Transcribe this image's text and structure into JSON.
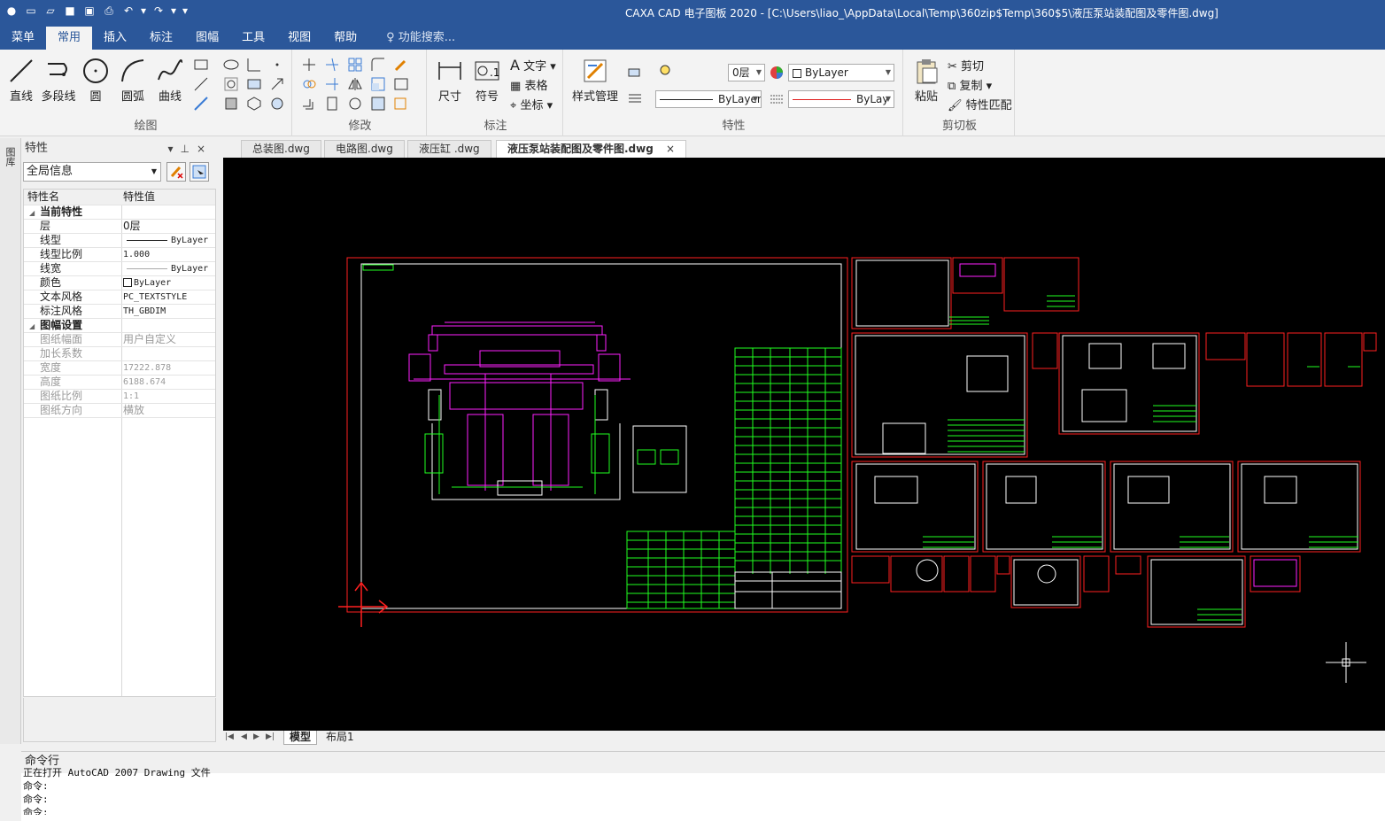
{
  "window": {
    "title": "CAXA CAD 电子图板 2020 - [C:\\Users\\liao_\\AppData\\Local\\Temp\\360zip$Temp\\360$5\\液压泵站装配图及零件图.dwg]"
  },
  "menu": {
    "tabs": [
      "菜单",
      "常用",
      "插入",
      "标注",
      "图幅",
      "工具",
      "视图",
      "帮助"
    ],
    "active": "常用",
    "search_placeholder": "功能搜索..."
  },
  "ribbon": {
    "draw": {
      "label": "绘图",
      "line": "直线",
      "polyline": "多段线",
      "circle": "圆",
      "arc": "圆弧",
      "curve": "曲线"
    },
    "modify": {
      "label": "修改"
    },
    "annotate": {
      "label": "标注",
      "dimension": "尺寸",
      "symbol": "符号",
      "text": "文字",
      "table": "表格",
      "coordinate": "坐标"
    },
    "properties": {
      "label": "特性",
      "style_manage": "样式管理",
      "layer": "0层",
      "color": "ByLayer",
      "linetype": "ByLayer",
      "linewidth": "ByLay"
    },
    "clipboard": {
      "label": "剪切板",
      "paste": "粘贴",
      "cut": "剪切",
      "copy": "复制",
      "match": "特性匹配"
    }
  },
  "left_strip": {
    "label": "图库"
  },
  "properties_panel": {
    "title": "特性",
    "combo": "全局信息",
    "header": {
      "name": "特性名",
      "value": "特性值"
    },
    "sections": [
      {
        "title": "当前特性",
        "rows": [
          {
            "name": "层",
            "value": "0层"
          },
          {
            "name": "线型",
            "value": "ByLayer"
          },
          {
            "name": "线型比例",
            "value": "1.000"
          },
          {
            "name": "线宽",
            "value": "ByLayer"
          },
          {
            "name": "颜色",
            "value": "ByLayer"
          },
          {
            "name": "文本风格",
            "value": "PC_TEXTSTYLE"
          },
          {
            "name": "标注风格",
            "value": "TH_GBDIM"
          }
        ]
      },
      {
        "title": "图幅设置",
        "rows": [
          {
            "name": "图纸幅面",
            "value": "用户自定义"
          },
          {
            "name": "加长系数",
            "value": ""
          },
          {
            "name": "宽度",
            "value": "17222.878"
          },
          {
            "name": "高度",
            "value": "6188.674"
          },
          {
            "name": "图纸比例",
            "value": "1:1"
          },
          {
            "name": "图纸方向",
            "value": "横放"
          }
        ]
      }
    ]
  },
  "doc_tabs": [
    "总装图.dwg",
    "电路图.dwg",
    "液压缸 .dwg",
    "液压泵站装配图及零件图.dwg"
  ],
  "active_doc": "液压泵站装配图及零件图.dwg",
  "layout_tabs": [
    "模型",
    "布局1"
  ],
  "command": {
    "title": "命令行",
    "lines": [
      "正在打开 AutoCAD 2007 Drawing 文件",
      "命令:",
      "命令:",
      "命令:"
    ]
  },
  "colors": {
    "titlebar": "#2b579a",
    "canvas": "#000000",
    "frame": "#ff2020",
    "drawing_green": "#20ff20",
    "drawing_magenta": "#ff20ff",
    "drawing_white": "#ffffff"
  }
}
